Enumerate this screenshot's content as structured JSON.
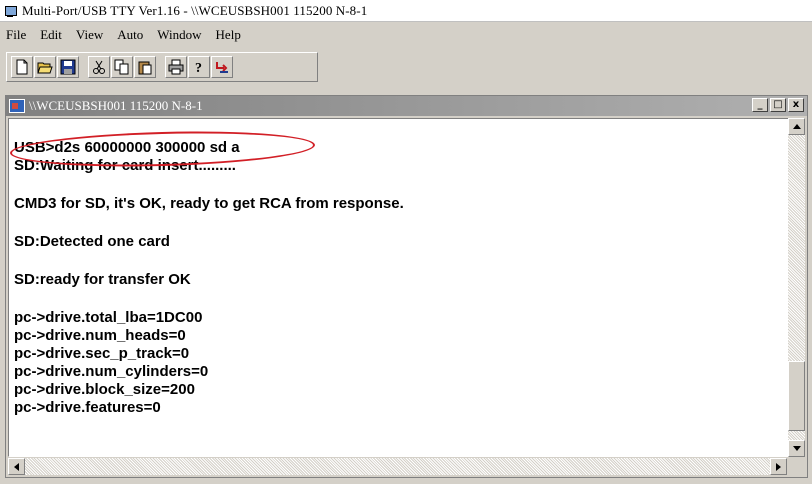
{
  "app": {
    "title": "Multi-Port/USB TTY Ver1.16 - \\\\WCEUSBSH001 115200  N-8-1"
  },
  "menu": [
    {
      "label": "File",
      "hotkey": "F"
    },
    {
      "label": "Edit",
      "hotkey": "E"
    },
    {
      "label": "View",
      "hotkey": "V"
    },
    {
      "label": "Auto",
      "hotkey": "A"
    },
    {
      "label": "Window",
      "hotkey": "W"
    },
    {
      "label": "Help",
      "hotkey": "H"
    }
  ],
  "toolbar": {
    "buttons": [
      "new-icon",
      "open-icon",
      "save-icon",
      "cut-icon",
      "copy-icon",
      "paste-icon",
      "print-icon",
      "help-icon",
      "connect-icon"
    ]
  },
  "child_window": {
    "title": "\\\\WCEUSBSH001 115200  N-8-1",
    "minimize": "_",
    "restore": "□",
    "close": "x"
  },
  "terminal": {
    "lines": [
      "USB>d2s 60000000 300000 sd a",
      "SD:Waiting for card insert.........",
      "",
      "CMD3 for SD, it's OK, ready to get RCA from response.",
      "",
      "SD:Detected one card",
      "",
      "SD:ready for transfer OK",
      "",
      "pc->drive.total_lba=1DC00",
      "pc->drive.num_heads=0",
      "pc->drive.sec_p_track=0",
      "pc->drive.num_cylinders=0",
      "pc->drive.block_size=200",
      "pc->drive.features=0"
    ]
  },
  "colors": {
    "highlight_circle": "#d21f26",
    "window_face": "#d4d0c8"
  }
}
